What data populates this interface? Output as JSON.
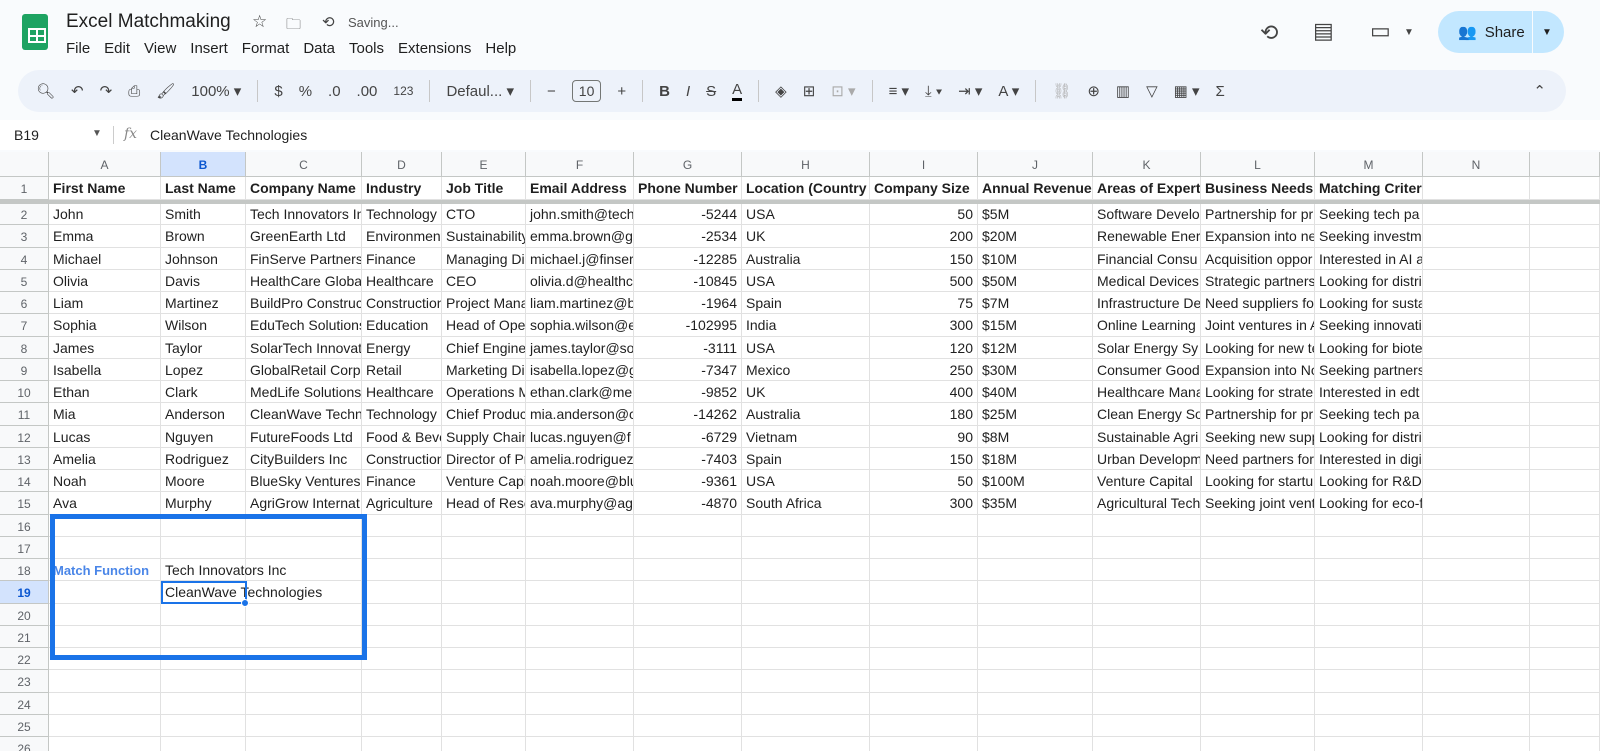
{
  "app": {
    "title": "Excel Matchmaking",
    "status": "Saving...",
    "menu": [
      "File",
      "Edit",
      "View",
      "Insert",
      "Format",
      "Data",
      "Tools",
      "Extensions",
      "Help"
    ],
    "share_label": "Share"
  },
  "toolbar": {
    "zoom": "100%",
    "currency": "$",
    "percent": "%",
    "dec_decrease": ".0",
    "dec_increase": ".00",
    "number_format": "123",
    "font": "Defaul...",
    "font_size": "10",
    "bold": "B",
    "italic": "I",
    "strike": "S",
    "text_color": "A",
    "sum": "Σ"
  },
  "formula_bar": {
    "cell_ref": "B19",
    "fx": "fx",
    "value": "CleanWave Technologies"
  },
  "columns": [
    "A",
    "B",
    "C",
    "D",
    "E",
    "F",
    "G",
    "H",
    "I",
    "J",
    "K",
    "L",
    "M",
    "N"
  ],
  "headers": [
    "First Name",
    "Last Name",
    "Company Name",
    "Industry",
    "Job Title",
    "Email Address",
    "Phone Number",
    "Location (Country",
    "Company Size",
    "Annual Revenue",
    "Areas of Expert",
    "Business Needs",
    "Matching Criter"
  ],
  "rows": [
    [
      "John",
      "Smith",
      "Tech Innovators Inc",
      "Technology",
      "CTO",
      "john.smith@tech",
      "-5244",
      "USA",
      "50",
      "$5M",
      "Software Develo",
      "Partnership for pr",
      "Seeking tech pa"
    ],
    [
      "Emma",
      "Brown",
      "GreenEarth Ltd",
      "Environment",
      "Sustainability",
      "emma.brown@g",
      "-2534",
      "UK",
      "200",
      "$20M",
      "Renewable Ener",
      "Expansion into ne",
      "Seeking investm"
    ],
    [
      "Michael",
      "Johnson",
      "FinServe Partners",
      "Finance",
      "Managing Di",
      "michael.j@finser",
      "-12285",
      "Australia",
      "150",
      "$10M",
      "Financial Consu",
      "Acquisition oppor",
      "Interested in AI a"
    ],
    [
      "Olivia",
      "Davis",
      "HealthCare Global",
      "Healthcare",
      "CEO",
      "olivia.d@healthc",
      "-10845",
      "USA",
      "500",
      "$50M",
      "Medical Devices",
      "Strategic partners",
      "Looking for distri"
    ],
    [
      "Liam",
      "Martinez",
      "BuildPro Construc",
      "Construction",
      "Project Mana",
      "liam.martinez@b",
      "-1964",
      "Spain",
      "75",
      "$7M",
      "Infrastructure De",
      "Need suppliers fo",
      "Looking for susta"
    ],
    [
      "Sophia",
      "Wilson",
      "EduTech Solutions",
      "Education",
      "Head of Ope",
      "sophia.wilson@e",
      "-102995",
      "India",
      "300",
      "$15M",
      "Online Learning",
      "Joint ventures in A",
      "Seeking innovati"
    ],
    [
      "James",
      "Taylor",
      "SolarTech Innovat",
      "Energy",
      "Chief Engine",
      "james.taylor@so",
      "-3111",
      "USA",
      "120",
      "$12M",
      "Solar Energy Sy",
      "Looking for new te",
      "Looking for biote"
    ],
    [
      "Isabella",
      "Lopez",
      "GlobalRetail Corp",
      "Retail",
      "Marketing Di",
      "isabella.lopez@g",
      "-7347",
      "Mexico",
      "250",
      "$30M",
      "Consumer Good",
      "Expansion into No",
      "Seeking partners"
    ],
    [
      "Ethan",
      "Clark",
      "MedLife Solutions",
      "Healthcare",
      "Operations M",
      "ethan.clark@me",
      "-9852",
      "UK",
      "400",
      "$40M",
      "Healthcare Mana",
      "Looking for strate",
      "Interested in edt"
    ],
    [
      "Mia",
      "Anderson",
      "CleanWave Techn",
      "Technology",
      "Chief Produc",
      "mia.anderson@c",
      "-14262",
      "Australia",
      "180",
      "$25M",
      "Clean Energy So",
      "Partnership for pr",
      "Seeking tech pa"
    ],
    [
      "Lucas",
      "Nguyen",
      "FutureFoods Ltd",
      "Food & Beve",
      "Supply Chain",
      "lucas.nguyen@f",
      "-6729",
      "Vietnam",
      "90",
      "$8M",
      "Sustainable Agri",
      "Seeking new supp",
      "Looking for distri"
    ],
    [
      "Amelia",
      "Rodriguez",
      "CityBuilders Inc",
      "Construction",
      "Director of Pr",
      "amelia.rodriguez",
      "-7403",
      "Spain",
      "150",
      "$18M",
      "Urban Developm",
      "Need partners for",
      "Interested in digi"
    ],
    [
      "Noah",
      "Moore",
      "BlueSky Ventures",
      "Finance",
      "Venture Capi",
      "noah.moore@blu",
      "-9361",
      "USA",
      "50",
      "$100M",
      "Venture Capital",
      "Looking for startu",
      "Looking for R&D"
    ],
    [
      "Ava",
      "Murphy",
      "AgriGrow Internat",
      "Agriculture",
      "Head of Rese",
      "ava.murphy@ag",
      "-4870",
      "South Africa",
      "300",
      "$35M",
      "Agricultural Tech",
      "Seeking joint vent",
      "Looking for eco-f"
    ]
  ],
  "match": {
    "label": "Match Function",
    "b18": "Tech Innovators Inc",
    "b19": "CleanWave Technologies"
  },
  "colors": {
    "accent": "#1a73e8",
    "share_bg": "#c2e7ff"
  }
}
